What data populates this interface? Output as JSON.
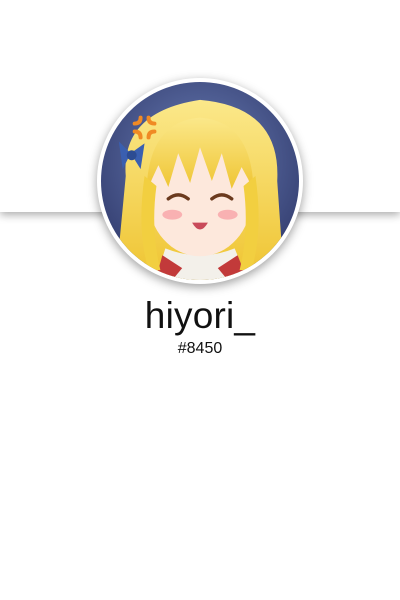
{
  "profile": {
    "username": "hiyori_",
    "discriminator": "#8450"
  },
  "icons": {
    "avatar": "anime-girl-avatar-icon"
  },
  "colors": {
    "background": "#ffffff",
    "text": "#111111",
    "hair": "#f7d64a",
    "ribbon": "#3a5fb0",
    "anger_mark": "#f08a24"
  }
}
